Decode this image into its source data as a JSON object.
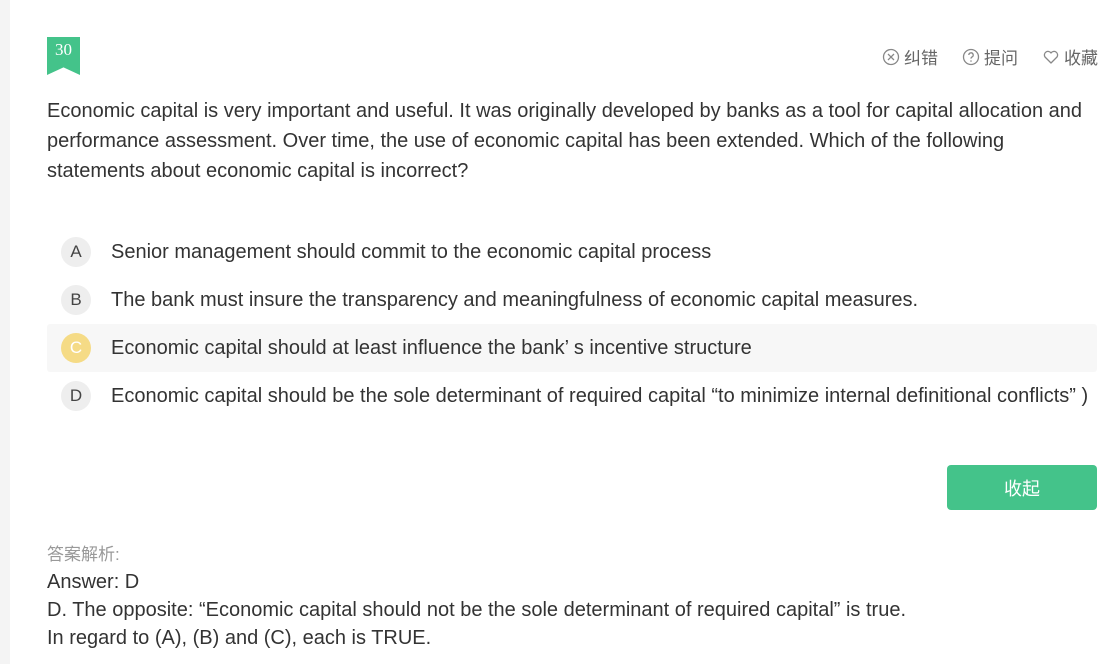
{
  "question": {
    "number": "30",
    "text": "Economic capital is very important and useful. It was originally developed by banks as a tool for capital allocation and performance assessment. Over time, the use of economic capital has been extended. Which of the following statements about economic capital is incorrect?"
  },
  "actions": {
    "report_label": "纠错",
    "ask_label": "提问",
    "favorite_label": "收藏"
  },
  "options": [
    {
      "letter": "A",
      "text": "Senior management should commit to the economic capital process"
    },
    {
      "letter": "B",
      "text": "The bank must insure the transparency and meaningfulness of economic capital measures."
    },
    {
      "letter": "C",
      "text": "Economic capital should at least influence the bank’ s incentive structure"
    },
    {
      "letter": "D",
      "text": "Economic capital should be the sole determinant of required capital “to minimize internal definitional conflicts” )"
    }
  ],
  "selected_option": "C",
  "collapse_label": "收起",
  "analysis": {
    "label": "答案解析:",
    "lines": [
      "Answer: D",
      "D. The opposite: “Economic capital should not be the sole determinant of required capital” is true.",
      "In regard to (A), (B) and (C), each is TRUE."
    ]
  },
  "colors": {
    "accent": "#44c38a",
    "selected_letter": "#f5db86"
  }
}
